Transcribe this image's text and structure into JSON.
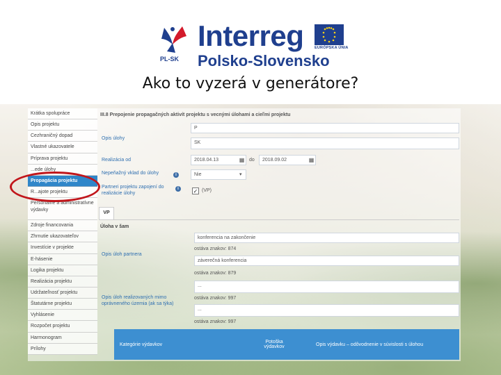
{
  "header": {
    "logo_mark_label": "PL-SK",
    "logo_word": "Interreg",
    "logo_sub": "Polsko-Slovensko",
    "eu_label": "EURÓPSKA ÚNIA"
  },
  "slide_title": "Ako to vyzerá v generátore?",
  "sidebar": {
    "items": [
      {
        "label": "Krátka spolupráce"
      },
      {
        "label": "Opis projektu"
      },
      {
        "label": "Cezhraničný dopad"
      },
      {
        "label": "Vlastné ukazovatele"
      },
      {
        "label": "Príprava projektu"
      },
      {
        "label": "...ede úlohy"
      },
      {
        "label": "Propagácia projektu"
      },
      {
        "label": "R...ajote projektu"
      },
      {
        "label": "Personálne a administratívne výdavky"
      },
      {
        "label": "Zdroje financovania"
      },
      {
        "label": "Zhrnutie ukazovateľov"
      },
      {
        "label": "Investície v projekte"
      },
      {
        "label": "E-hásenie"
      },
      {
        "label": "Logika projektu"
      },
      {
        "label": "Realizácia projektu"
      },
      {
        "label": "Udržateľnosť projektu"
      },
      {
        "label": "Štatutárne projektu"
      },
      {
        "label": "Vyhlásenie"
      },
      {
        "label": "Rozpočet projektu"
      },
      {
        "label": "Harmonogram"
      },
      {
        "label": "Prílohy"
      }
    ]
  },
  "content": {
    "section_title": "III.8 Prepojenie propagačných aktivít projektu s vecnými úlohami a cieľmi projektu",
    "field_top_value": "P",
    "opis_label": "Opis úlohy",
    "opis_value": "SK",
    "realizacia_label": "Realizácia od",
    "date_from": "2018.04.13",
    "do_label": "do",
    "date_to": "2018.09.02",
    "vklad_label": "Nepeňažný vklad do úlohy",
    "vklad_value": "Nie",
    "partneri_label": "Partneri projektu zapojení do realizácie úlohy",
    "partner_vp": "(VP)",
    "tab_vp": "VP",
    "uloha_label": "Úloha v šam",
    "text1": "konferencia na zakončenie",
    "remain1": "ostáva znakov: 874",
    "opis_partnera_label": "Opis úloh partnera",
    "text2": "záverečná konferencia",
    "remain2": "ostáva znakov: 879",
    "text3": "...",
    "remain3": "ostáva znakov: 997",
    "opis_mimo_label": "Opis úloh realizovaných mimo oprávneného územia (ak sa týka)",
    "text4": "...",
    "remain4": "ostáva znakov: 997"
  },
  "table": {
    "col1": "Kategórie výdavkov",
    "col2": "Potoška výdavkov",
    "col3": "Opis výdavku – odôvodnenie v súvislosti s úlohou"
  },
  "colors": {
    "brand_blue": "#1f3f8e",
    "active_blue": "#2f86c9",
    "table_blue": "#3d8fd1",
    "highlight_red": "#c1161b"
  }
}
